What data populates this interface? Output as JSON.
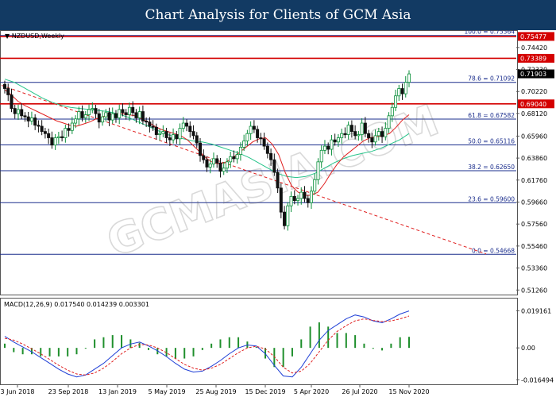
{
  "header": {
    "title": "Chart Analysis for Clients of GCM Asia"
  },
  "chart_data": [
    {
      "type": "candlestick",
      "symbol": "NZDUSD,Weekly",
      "ylim": [
        0.509,
        0.76
      ],
      "y_ticks": [
        "0.74420",
        "0.72330",
        "0.70220",
        "0.68120",
        "0.65960",
        "0.63860",
        "0.61760",
        "0.59660",
        "0.57560",
        "0.55460",
        "0.53360",
        "0.51260"
      ],
      "x_ticks": [
        "3 Jun 2018",
        "23 Sep 2018",
        "13 Jan 2019",
        "5 May 2019",
        "25 Aug 2019",
        "15 Dec 2019",
        "5 Apr 2020",
        "26 Jul 2020",
        "15 Nov 2020"
      ],
      "current_price": "0.71903",
      "fib_levels": [
        {
          "label": "100.0 = 0.75564",
          "value": 0.75564
        },
        {
          "label": "78.6 = 0.71092",
          "value": 0.71092
        },
        {
          "label": "61.8 = 0.67582",
          "value": 0.67582
        },
        {
          "label": "50.0 = 0.65116",
          "value": 0.65116
        },
        {
          "label": "38.2 = 0.62650",
          "value": 0.6265
        },
        {
          "label": "23.6 = 0.59600",
          "value": 0.596
        },
        {
          "label": "0.0 = 0.54668",
          "value": 0.54668
        }
      ],
      "horizontal_levels": [
        {
          "label": "0.75477",
          "value": 0.75477,
          "color": "#d40000"
        },
        {
          "label": "0.73389",
          "value": 0.73389,
          "color": "#d40000"
        },
        {
          "label": "0.69040",
          "value": 0.6904,
          "color": "#d40000"
        }
      ],
      "series": [
        {
          "name": "Price",
          "type": "candlestick",
          "color_up": "#0a8f3a",
          "color_down": "#111111"
        },
        {
          "name": "MA fast",
          "color": "#e02020"
        },
        {
          "name": "MA slow",
          "color": "#27c48a"
        },
        {
          "name": "Trend",
          "color": "#e02020",
          "style": "dashed"
        }
      ],
      "closes": [
        0.705,
        0.699,
        0.686,
        0.681,
        0.685,
        0.679,
        0.678,
        0.674,
        0.677,
        0.67,
        0.669,
        0.664,
        0.662,
        0.658,
        0.651,
        0.658,
        0.659,
        0.658,
        0.667,
        0.665,
        0.672,
        0.676,
        0.683,
        0.677,
        0.68,
        0.685,
        0.686,
        0.681,
        0.673,
        0.678,
        0.682,
        0.675,
        0.681,
        0.677,
        0.685,
        0.682,
        0.68,
        0.687,
        0.682,
        0.677,
        0.683,
        0.674,
        0.673,
        0.669,
        0.668,
        0.661,
        0.662,
        0.664,
        0.658,
        0.656,
        0.661,
        0.657,
        0.667,
        0.672,
        0.669,
        0.664,
        0.66,
        0.653,
        0.641,
        0.637,
        0.63,
        0.633,
        0.638,
        0.634,
        0.626,
        0.629,
        0.635,
        0.64,
        0.638,
        0.642,
        0.649,
        0.655,
        0.662,
        0.669,
        0.666,
        0.658,
        0.657,
        0.65,
        0.643,
        0.637,
        0.625,
        0.61,
        0.587,
        0.574,
        0.593,
        0.602,
        0.598,
        0.6,
        0.606,
        0.6,
        0.596,
        0.607,
        0.618,
        0.635,
        0.646,
        0.65,
        0.647,
        0.656,
        0.654,
        0.658,
        0.662,
        0.661,
        0.67,
        0.664,
        0.66,
        0.661,
        0.672,
        0.662,
        0.658,
        0.654,
        0.66,
        0.664,
        0.659,
        0.667,
        0.679,
        0.687,
        0.698,
        0.705,
        0.7,
        0.711,
        0.719
      ],
      "ma_fast": [
        0.704,
        0.699,
        0.693,
        0.689,
        0.686,
        0.683,
        0.68,
        0.677,
        0.674,
        0.672,
        0.67,
        0.669,
        0.671,
        0.673,
        0.676,
        0.678,
        0.68,
        0.681,
        0.681,
        0.68,
        0.679,
        0.676,
        0.673,
        0.669,
        0.666,
        0.664,
        0.662,
        0.66,
        0.656,
        0.65,
        0.644,
        0.638,
        0.634,
        0.633,
        0.635,
        0.639,
        0.644,
        0.649,
        0.654,
        0.657,
        0.658,
        0.652,
        0.642,
        0.625,
        0.612,
        0.606,
        0.603,
        0.603,
        0.606,
        0.614,
        0.624,
        0.633,
        0.64,
        0.645,
        0.65,
        0.655,
        0.658,
        0.659,
        0.66,
        0.662,
        0.668,
        0.675,
        0.68
      ],
      "ma_slow": [
        0.714,
        0.711,
        0.706,
        0.701,
        0.696,
        0.692,
        0.689,
        0.687,
        0.686,
        0.685,
        0.684,
        0.683,
        0.681,
        0.678,
        0.674,
        0.67,
        0.666,
        0.662,
        0.659,
        0.657,
        0.655,
        0.654,
        0.652,
        0.649,
        0.646,
        0.643,
        0.639,
        0.634,
        0.629,
        0.624,
        0.621,
        0.62,
        0.621,
        0.624,
        0.629,
        0.634,
        0.638,
        0.641,
        0.643,
        0.645,
        0.648,
        0.652,
        0.656,
        0.662
      ]
    },
    {
      "type": "line",
      "title": "MACD(12,26,9) 0.017540 0.014239 0.003301",
      "ylim": [
        -0.018,
        0.021
      ],
      "y_ticks": [
        "0.019161",
        "0.00",
        "-0.016494"
      ],
      "series": [
        {
          "name": "MACD",
          "color": "#1f3fd6",
          "values": [
            0.006,
            0.003,
            0.0005,
            -0.002,
            -0.005,
            -0.008,
            -0.011,
            -0.0135,
            -0.015,
            -0.014,
            -0.011,
            -0.008,
            -0.004,
            0.0,
            0.002,
            0.003,
            0.001,
            -0.0015,
            -0.0045,
            -0.008,
            -0.011,
            -0.0125,
            -0.012,
            -0.0095,
            -0.0065,
            -0.003,
            0.0,
            0.0015,
            0.001,
            -0.003,
            -0.009,
            -0.0145,
            -0.015,
            -0.01,
            -0.003,
            0.004,
            0.009,
            0.012,
            0.015,
            0.017,
            0.016,
            0.014,
            0.013,
            0.015,
            0.0175,
            0.0191
          ]
        },
        {
          "name": "Signal",
          "color": "#e02020",
          "style": "dashed",
          "values": [
            0.005,
            0.004,
            0.002,
            -0.0005,
            -0.003,
            -0.006,
            -0.009,
            -0.0115,
            -0.0135,
            -0.014,
            -0.013,
            -0.0105,
            -0.007,
            -0.003,
            0.0,
            0.0018,
            0.0015,
            0.0,
            -0.0025,
            -0.0055,
            -0.0085,
            -0.0105,
            -0.0115,
            -0.0105,
            -0.0085,
            -0.0055,
            -0.0025,
            0.0,
            0.0008,
            -0.0005,
            -0.0045,
            -0.01,
            -0.013,
            -0.012,
            -0.008,
            -0.002,
            0.004,
            0.0085,
            0.0115,
            0.014,
            0.015,
            0.0142,
            0.0136,
            0.014,
            0.015,
            0.0165
          ]
        }
      ]
    }
  ]
}
